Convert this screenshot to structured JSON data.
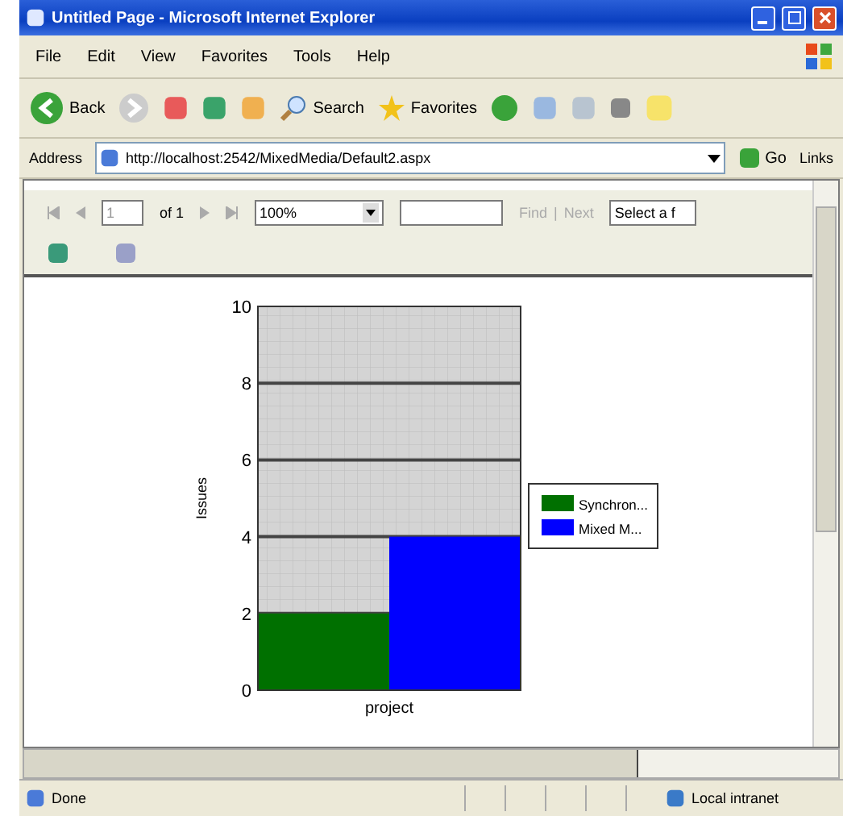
{
  "window": {
    "title": "Untitled Page - Microsoft Internet Explorer"
  },
  "menu": [
    "File",
    "Edit",
    "View",
    "Favorites",
    "Tools",
    "Help"
  ],
  "toolbar": {
    "back": "Back",
    "search": "Search",
    "favorites": "Favorites"
  },
  "address_bar": {
    "label": "Address",
    "value": "http://localhost:2542/MixedMedia/Default2.aspx",
    "go": "Go",
    "links": "Links"
  },
  "report_toolbar": {
    "page": "1",
    "page_count": "of 1",
    "zoom": "100%",
    "find": "Find",
    "separator": "|",
    "next": "Next",
    "export": "Select a f"
  },
  "chart": {
    "chart_data": {
      "type": "bar",
      "xlabel": "project",
      "ylabel": "Issues",
      "ylim": [
        0,
        10
      ],
      "grid": true,
      "legend": true,
      "yticks": [
        0,
        2,
        4,
        6,
        8,
        10
      ],
      "series": [
        {
          "name": "Synchron...",
          "color": "#007000",
          "values": [
            2
          ]
        },
        {
          "name": "Mixed M...",
          "color": "#0000ff",
          "values": [
            4
          ]
        }
      ]
    }
  },
  "status_bar": {
    "status": "Done",
    "zone": "Local intranet"
  }
}
